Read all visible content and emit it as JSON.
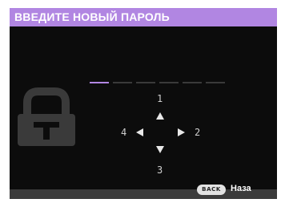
{
  "title": "ВВЕДИТЕ НОВЫЙ ПАРОЛЬ",
  "password_entry": {
    "slots": 6,
    "active_slot": 1,
    "accent_color": "#b186e2"
  },
  "keypad": {
    "up_digit": "1",
    "right_digit": "2",
    "down_digit": "3",
    "left_digit": "4"
  },
  "footer": {
    "back_key": "BACK",
    "back_label": "Наза"
  },
  "icons": [
    "lock-icon",
    "arrow-up-icon",
    "arrow-down-icon",
    "arrow-left-icon",
    "arrow-right-icon"
  ]
}
